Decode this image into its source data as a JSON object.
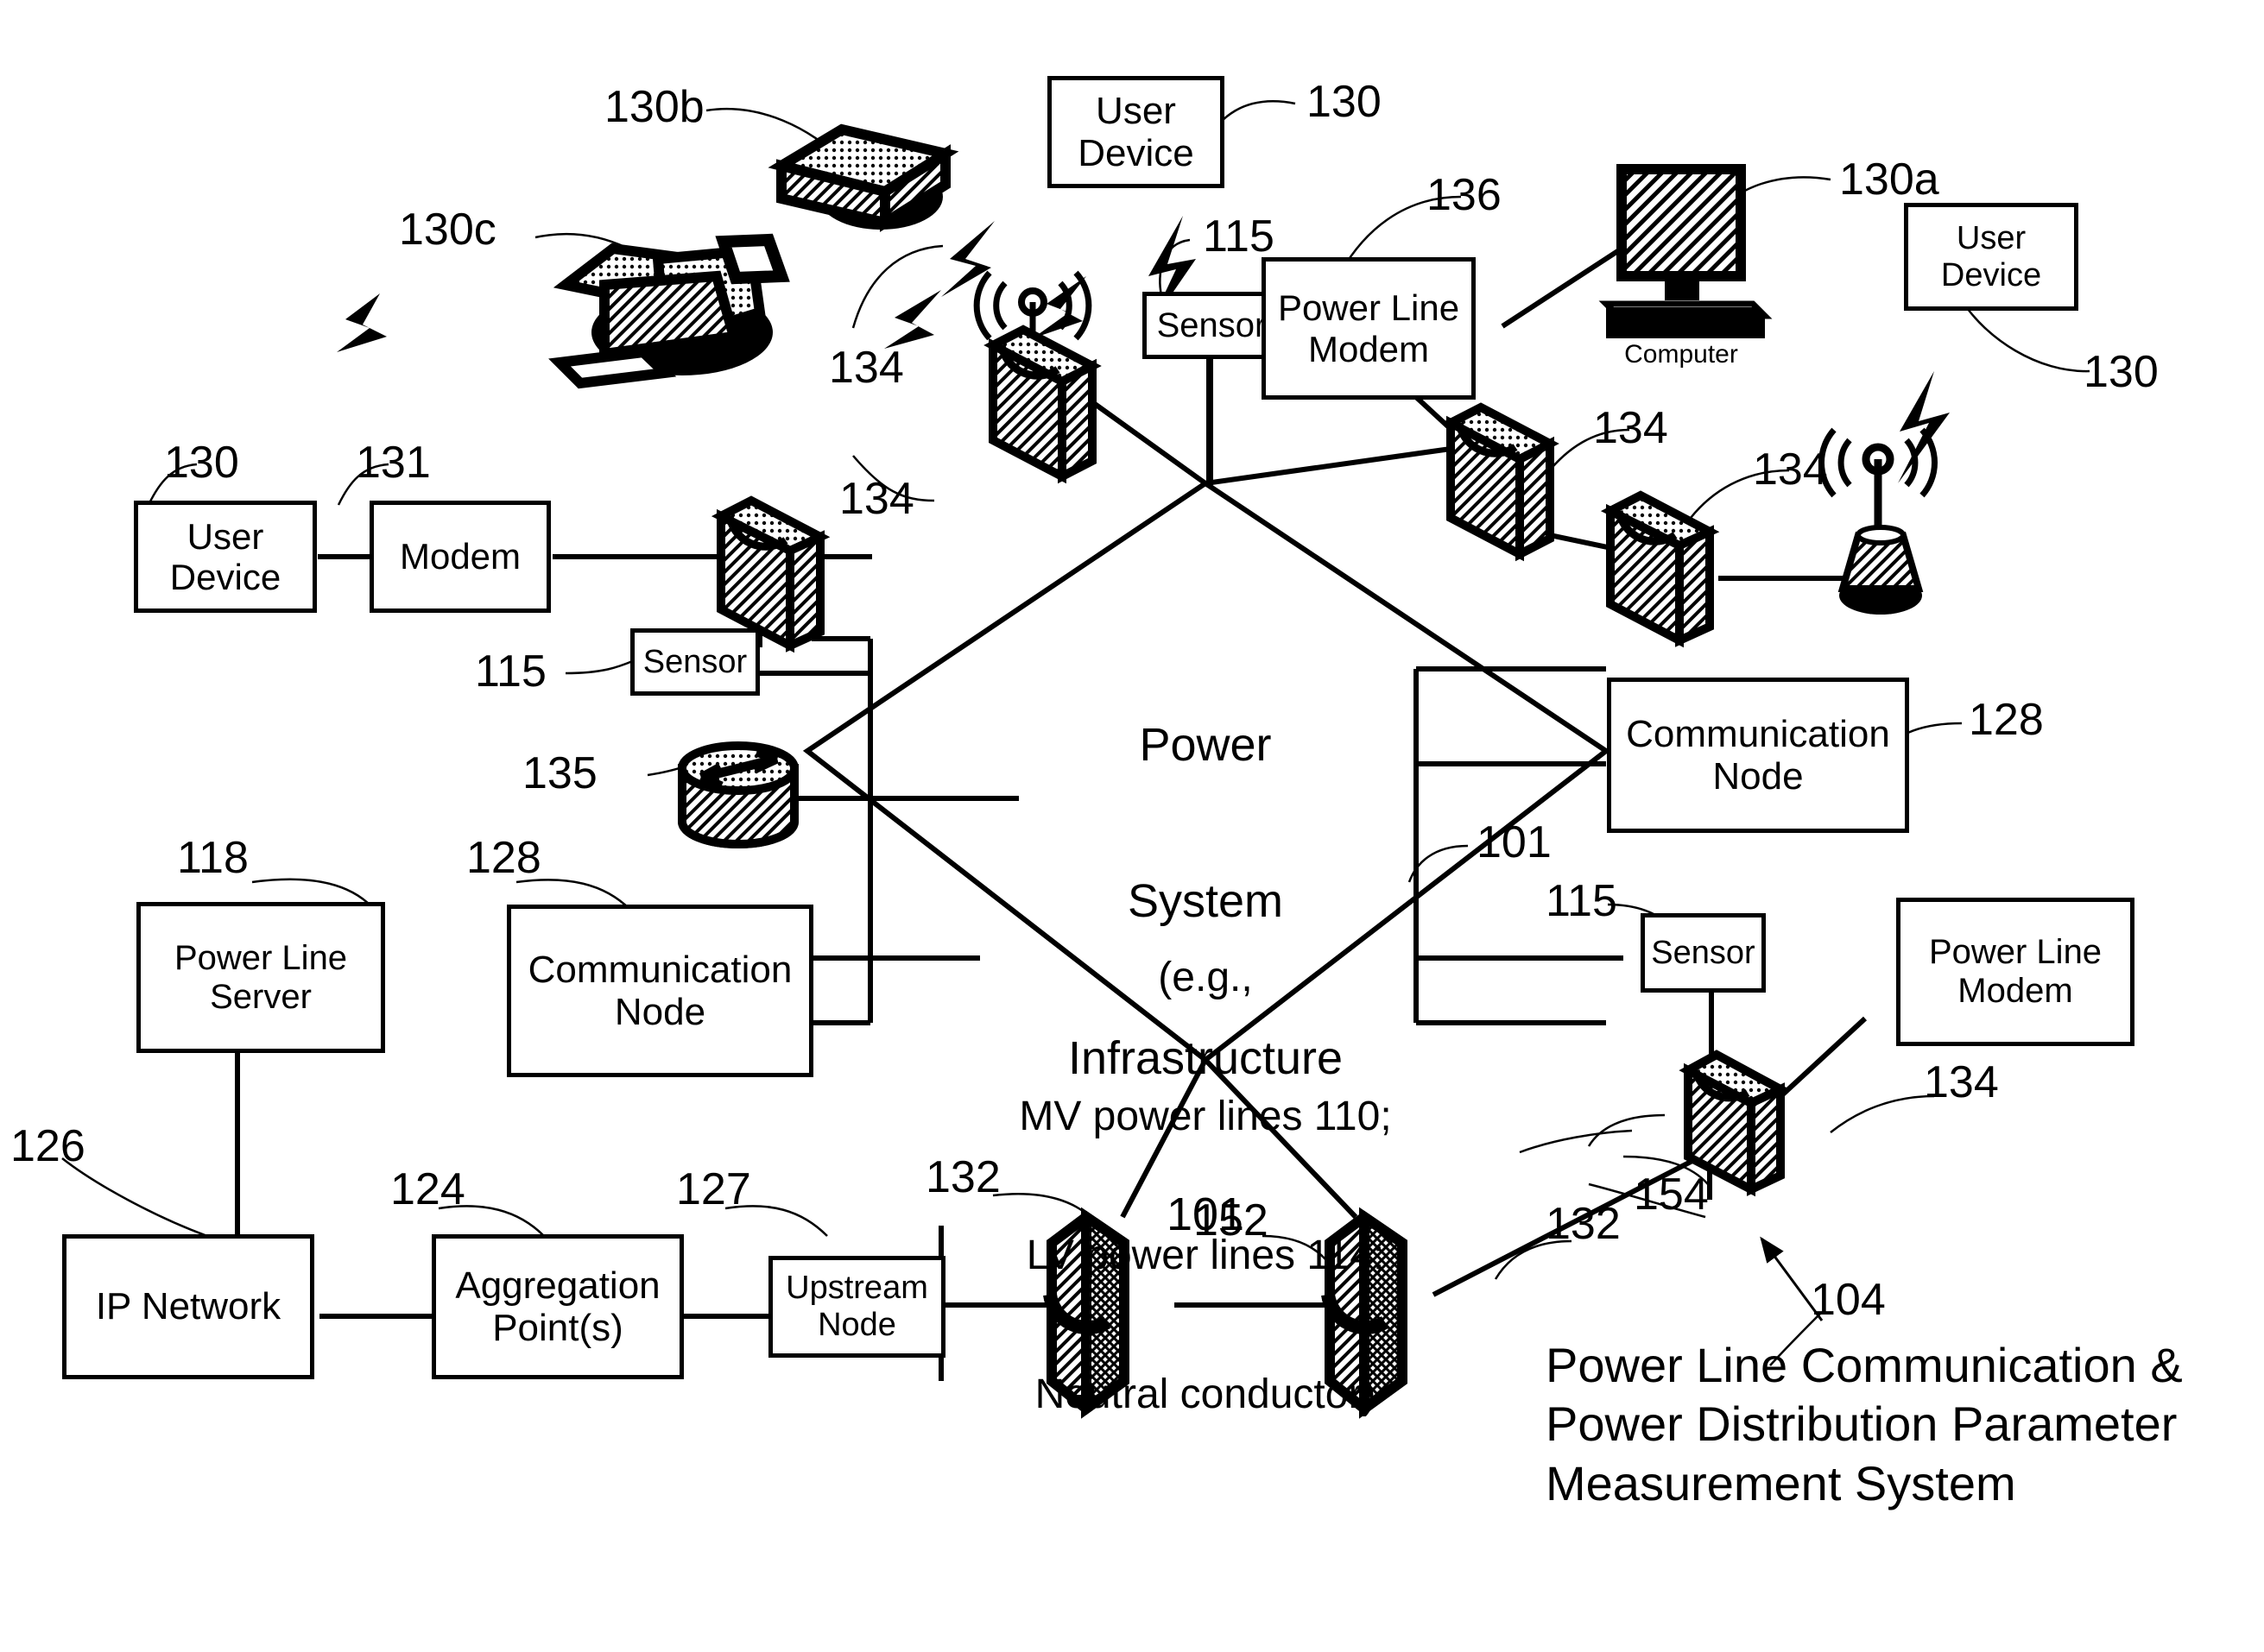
{
  "figure": {
    "title_caption": "Power Line Communication &\nPower Distribution Parameter\nMeasurement System",
    "caption_ref": "104"
  },
  "center": {
    "title_line1": "Power",
    "title_line2": "System",
    "title_line3": "Infrastructure",
    "title_ref": "101",
    "sub_line1": "(e.g.,",
    "sub_line2": "MV power lines 110;",
    "sub_line3": "LV power lines 114;",
    "sub_line4": "Neutral conductor)"
  },
  "boxes": {
    "user_device_top": "User\nDevice",
    "user_device_right": "User\nDevice",
    "user_device_left": "User\nDevice",
    "modem_left": "Modem",
    "sensor_top": "Sensor",
    "sensor_left": "Sensor",
    "sensor_right": "Sensor",
    "power_line_modem_top": "Power Line\nModem",
    "power_line_modem_right": "Power Line\nModem",
    "communication_node_right": "Communication\nNode",
    "communication_node_left": "Communication\nNode",
    "power_line_server": "Power Line\nServer",
    "ip_network": "IP Network",
    "aggregation_points": "Aggregation\nPoint(s)",
    "upstream_node": "Upstream\nNode"
  },
  "icon_labels": {
    "computer": "Computer"
  },
  "refs": {
    "r130b": "130b",
    "r130c": "130c",
    "r130_top": "130",
    "r115_top": "115",
    "r136": "136",
    "r130a": "130a",
    "r130_right": "130",
    "r134_topleft": "134",
    "r134_topright": "134",
    "r134_right": "134",
    "r130_left": "130",
    "r131": "131",
    "r134_left": "134",
    "r115_left": "115",
    "r135": "135",
    "r128_right": "128",
    "r101_right": "101",
    "r115_right": "115",
    "r118": "118",
    "r128_left": "128",
    "r126": "126",
    "r124": "124",
    "r127": "127",
    "r132_left": "132",
    "r152": "152",
    "r132_right": "132",
    "r154": "154",
    "r134_bottomright": "134",
    "r104": "104"
  },
  "colors": {
    "line": "#000000",
    "fill": "#ffffff",
    "hatch": "#000000"
  }
}
